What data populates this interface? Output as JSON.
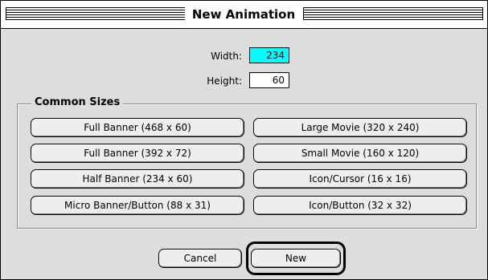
{
  "window": {
    "title": "New Animation"
  },
  "fields": {
    "width": {
      "label": "Width:",
      "value": "234"
    },
    "height": {
      "label": "Height:",
      "value": "60"
    }
  },
  "group": {
    "title": "Common Sizes",
    "buttons_left": [
      "Full Banner (468 x 60)",
      "Full Banner (392 x 72)",
      "Half Banner (234 x 60)",
      "Micro Banner/Button (88 x 31)"
    ],
    "buttons_right": [
      "Large Movie (320 x 240)",
      "Small Movie (160 x 120)",
      "Icon/Cursor (16 x 16)",
      "Icon/Button (32 x 32)"
    ]
  },
  "actions": {
    "cancel": "Cancel",
    "new": "New"
  },
  "colors": {
    "active_field": "#00ffff",
    "dialog_bg": "#dddddd"
  }
}
